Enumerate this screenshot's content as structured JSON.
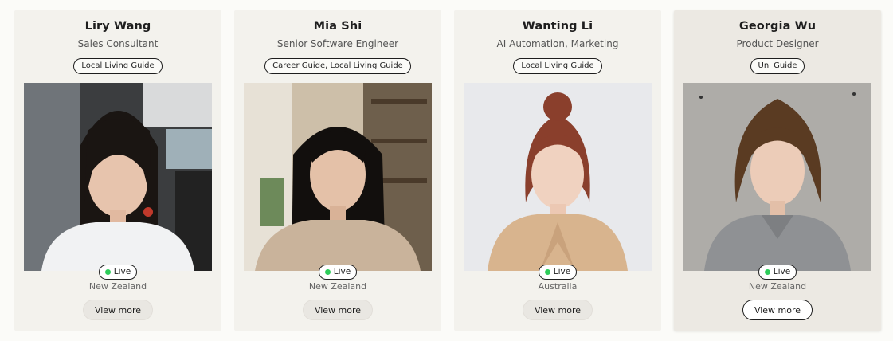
{
  "colors": {
    "card_bg": "#f3f2ed",
    "card_hover_bg": "#ece9e3",
    "live_dot": "#2ecc5a",
    "text": "#1e1e1e"
  },
  "cards": [
    {
      "name": "Liry Wang",
      "role": "Sales Consultant",
      "tags": [
        "Local Living Guide"
      ],
      "status": "Live",
      "location": "New Zealand",
      "button_label": "View more"
    },
    {
      "name": "Mia Shi",
      "role": "Senior Software Engineer",
      "tags": [
        "Career Guide, Local Living Guide"
      ],
      "status": "Live",
      "location": "New Zealand",
      "button_label": "View more"
    },
    {
      "name": "Wanting Li",
      "role": "AI Automation, Marketing",
      "tags": [
        "Local Living Guide"
      ],
      "status": "Live",
      "location": "Australia",
      "button_label": "View more"
    },
    {
      "name": "Georgia Wu",
      "role": "Product Designer",
      "tags": [
        "Uni Guide"
      ],
      "status": "Live",
      "location": "New Zealand",
      "button_label": "View more"
    }
  ]
}
